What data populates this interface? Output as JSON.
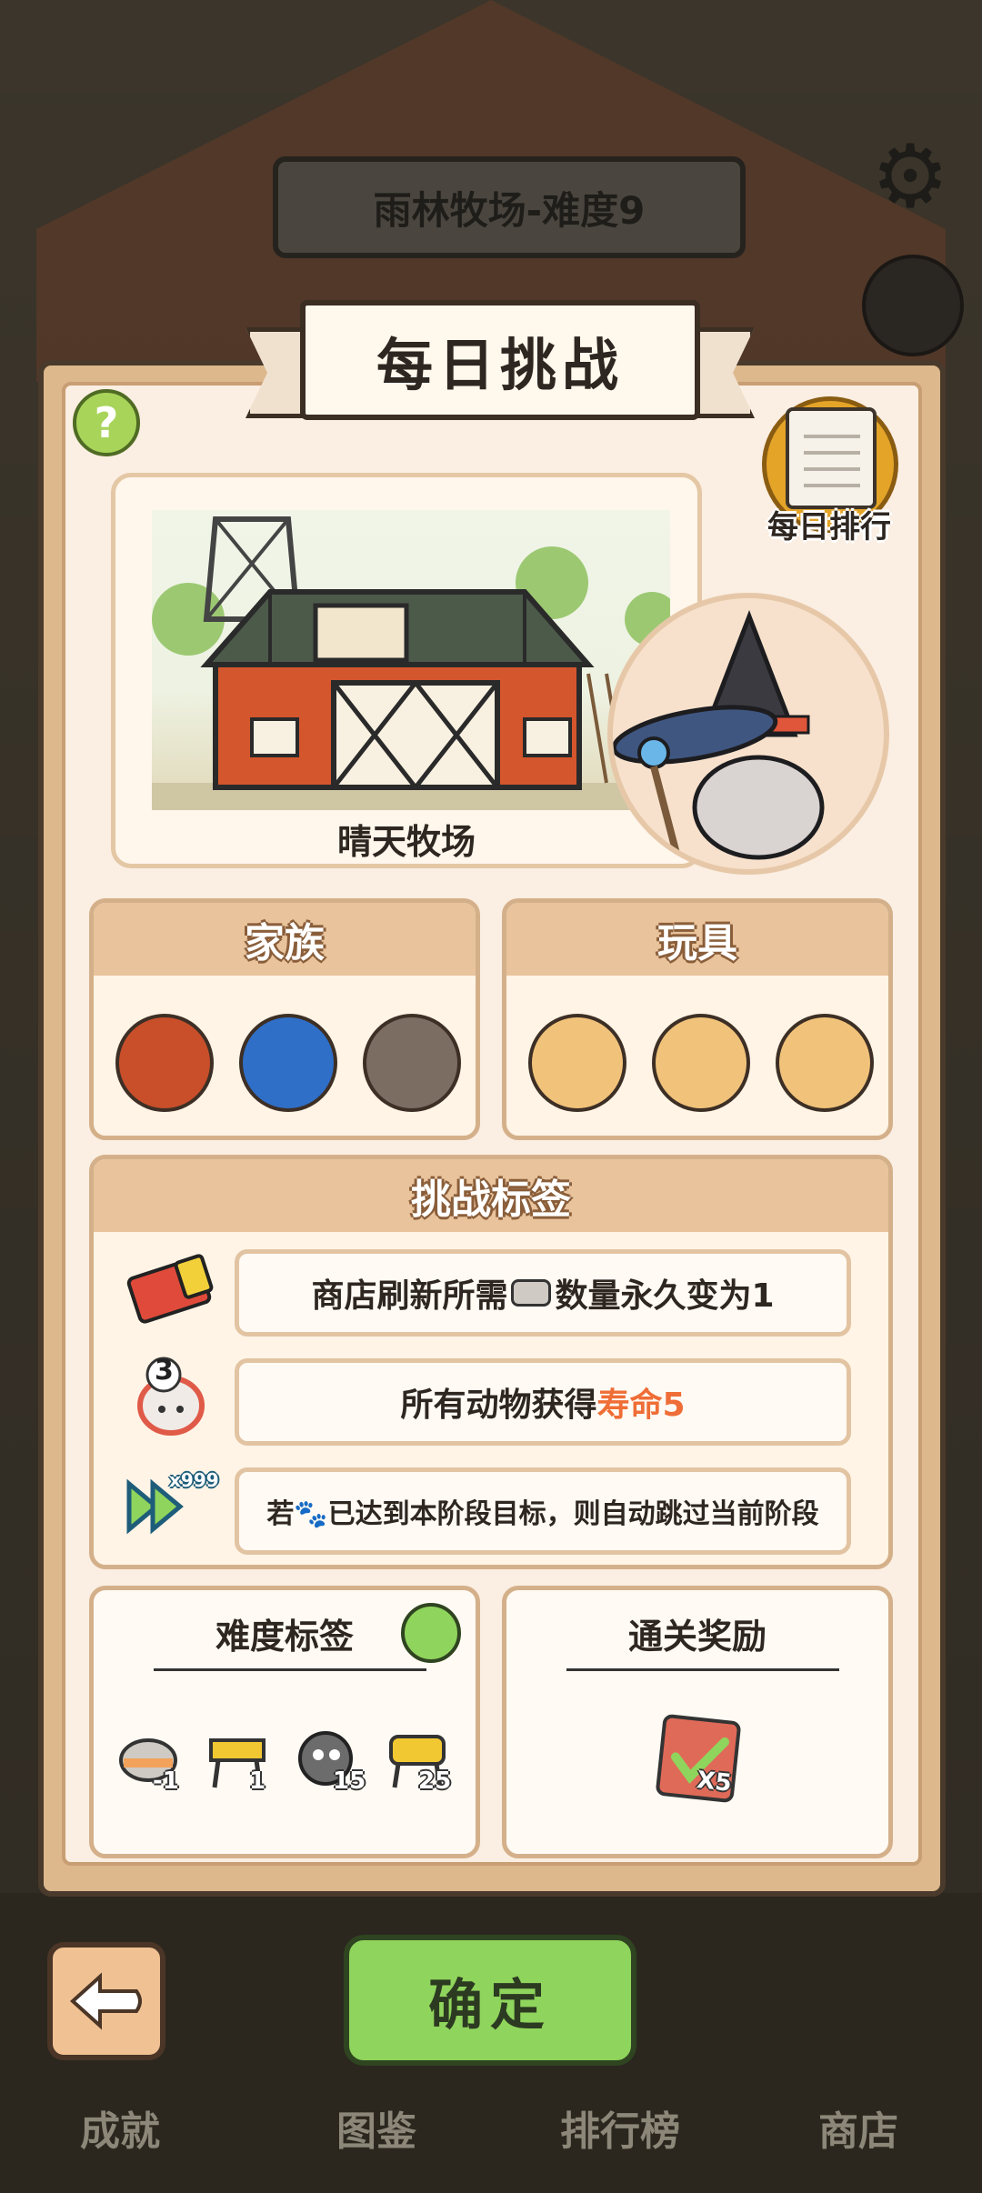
{
  "stage_title": "雨林牧场-难度9",
  "challenge_title": "每日挑战",
  "rank_label": "每日排行",
  "help_symbol": "?",
  "map": {
    "name": "晴天牧场"
  },
  "family": {
    "title": "家族",
    "icons": [
      "chicken-icon",
      "fish-icon",
      "alpaca-icon"
    ]
  },
  "toys": {
    "title": "玩具",
    "icons": [
      "phone-toy-icon",
      "jar-toy-icon",
      "bowl-toy-icon"
    ]
  },
  "challenge_tags": {
    "title": "挑战标签",
    "rows": [
      {
        "icon": "vip-ticket-icon",
        "pre": "商店刷新所需",
        "post": "数量永久变为1"
      },
      {
        "icon": "egg-3-icon",
        "pre": "所有动物获得",
        "highlight": "寿命5"
      },
      {
        "icon": "fast-forward-x999-icon",
        "text": "若🐾已达到本阶段目标，则自动跳过当前阶段",
        "badge": "x999"
      }
    ],
    "egg_number": "3"
  },
  "difficulty_tags": {
    "title": "难度标签",
    "items": [
      {
        "icon": "can-icon",
        "value": "-1"
      },
      {
        "icon": "barrier-icon",
        "value": "1"
      },
      {
        "icon": "ghost-icon",
        "value": "15"
      },
      {
        "icon": "barrier-big-icon",
        "value": "25"
      }
    ]
  },
  "reward": {
    "title": "通关奖励",
    "icon": "checklist-card-icon",
    "count": "X5"
  },
  "confirm_label": "确定",
  "bottom_tabs": [
    "成就",
    "图鉴",
    "排行榜",
    "商店"
  ],
  "colors": {
    "accent_green": "#8fd45c",
    "panel": "#dcb88c",
    "highlight": "#ef6d36"
  }
}
